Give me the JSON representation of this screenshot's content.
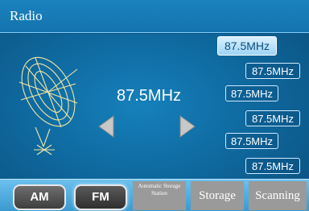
{
  "header": {
    "title": "Radio"
  },
  "tuner": {
    "frequency": "87.5MHz"
  },
  "presets": [
    {
      "label": "87.5MHz",
      "active": true
    },
    {
      "label": "87.5MHz",
      "active": false
    },
    {
      "label": "87.5MHz",
      "active": false
    },
    {
      "label": "87.5MHz",
      "active": false
    },
    {
      "label": "87.5MHz",
      "active": false
    },
    {
      "label": "87.5MHz",
      "active": false
    }
  ],
  "bottom": {
    "am_label": "AM",
    "fm_label": "FM",
    "auto_store_label": "Automatic Storage Station",
    "storage_label": "Storage",
    "scanning_label": "Scanning",
    "active_band": "FM"
  },
  "colors": {
    "accent": "#1474ad",
    "preset_border": "#cfeaff",
    "bottom_button": "#9a9a9a"
  }
}
